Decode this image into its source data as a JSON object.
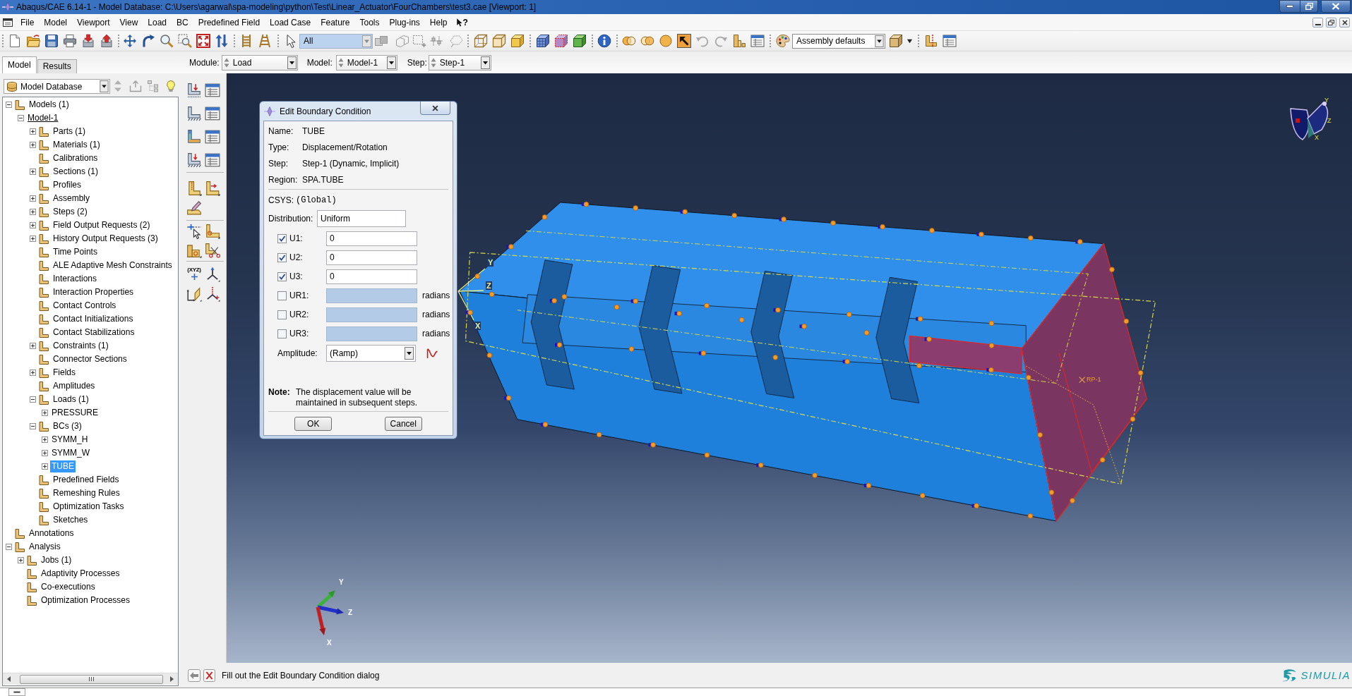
{
  "window": {
    "title": "Abaqus/CAE 6.14-1 - Model Database: C:\\Users\\agarwal\\spa-modeling\\python\\Test\\Linear_Actuator\\FourChambers\\test3.cae [Viewport: 1]"
  },
  "menu_bar": {
    "items": [
      "File",
      "Model",
      "Viewport",
      "View",
      "Load",
      "BC",
      "Predefined Field",
      "Load Case",
      "Feature",
      "Tools",
      "Plug-ins",
      "Help"
    ],
    "whats_this": "?"
  },
  "toolbar": {
    "selection_filter": "All",
    "render_style": "Assembly defaults"
  },
  "context_bar": {
    "fields": [
      {
        "label": "Module:",
        "value": "Load"
      },
      {
        "label": "Model:",
        "value": "Model-1"
      },
      {
        "label": "Step:",
        "value": "Step-1"
      }
    ]
  },
  "left_panel": {
    "tabs": [
      {
        "label": "Model",
        "selected": true
      },
      {
        "label": "Results",
        "selected": false
      }
    ],
    "database_selector": "Model Database",
    "tree": [
      {
        "label": "Models (1)",
        "kind": "container",
        "expanded": true,
        "selected": false,
        "current": false,
        "children": [
          {
            "label": "Model-1",
            "kind": "object",
            "expanded": true,
            "selected": false,
            "current": true,
            "children": [
              {
                "label": "Parts (1)",
                "kind": "container",
                "expanded": false,
                "selected": false,
                "current": false
              },
              {
                "label": "Materials (1)",
                "kind": "container",
                "expanded": false,
                "selected": false,
                "current": false
              },
              {
                "label": "Calibrations",
                "kind": "leaf",
                "selected": false,
                "current": false
              },
              {
                "label": "Sections (1)",
                "kind": "container",
                "expanded": false,
                "selected": false,
                "current": false
              },
              {
                "label": "Profiles",
                "kind": "leaf",
                "selected": false,
                "current": false
              },
              {
                "label": "Assembly",
                "kind": "container",
                "expanded": false,
                "selected": false,
                "current": false
              },
              {
                "label": "Steps (2)",
                "kind": "container",
                "expanded": false,
                "selected": false,
                "current": false
              },
              {
                "label": "Field Output Requests (2)",
                "kind": "container",
                "expanded": false,
                "selected": false,
                "current": false
              },
              {
                "label": "History Output Requests (3)",
                "kind": "container",
                "expanded": false,
                "selected": false,
                "current": false
              },
              {
                "label": "Time Points",
                "kind": "leaf",
                "selected": false,
                "current": false
              },
              {
                "label": "ALE Adaptive Mesh Constraints",
                "kind": "leaf",
                "selected": false,
                "current": false
              },
              {
                "label": "Interactions",
                "kind": "leaf",
                "selected": false,
                "current": false
              },
              {
                "label": "Interaction Properties",
                "kind": "leaf",
                "selected": false,
                "current": false
              },
              {
                "label": "Contact Controls",
                "kind": "leaf",
                "selected": false,
                "current": false
              },
              {
                "label": "Contact Initializations",
                "kind": "leaf",
                "selected": false,
                "current": false
              },
              {
                "label": "Contact Stabilizations",
                "kind": "leaf",
                "selected": false,
                "current": false
              },
              {
                "label": "Constraints (1)",
                "kind": "container",
                "expanded": false,
                "selected": false,
                "current": false
              },
              {
                "label": "Connector Sections",
                "kind": "leaf",
                "selected": false,
                "current": false
              },
              {
                "label": "Fields",
                "kind": "container",
                "expanded": false,
                "selected": false,
                "current": false
              },
              {
                "label": "Amplitudes",
                "kind": "leaf",
                "selected": false,
                "current": false
              },
              {
                "label": "Loads (1)",
                "kind": "container",
                "expanded": true,
                "selected": false,
                "current": false,
                "children": [
                  {
                    "label": "PRESSURE",
                    "kind": "object",
                    "expanded": false,
                    "selected": false,
                    "current": false
                  }
                ]
              },
              {
                "label": "BCs (3)",
                "kind": "container",
                "expanded": true,
                "selected": false,
                "current": false,
                "children": [
                  {
                    "label": "SYMM_H",
                    "kind": "object",
                    "expanded": false,
                    "selected": false,
                    "current": false
                  },
                  {
                    "label": "SYMM_W",
                    "kind": "object",
                    "expanded": false,
                    "selected": false,
                    "current": false
                  },
                  {
                    "label": "TUBE",
                    "kind": "object",
                    "expanded": false,
                    "selected": true,
                    "current": false
                  }
                ]
              },
              {
                "label": "Predefined Fields",
                "kind": "leaf",
                "selected": false,
                "current": false
              },
              {
                "label": "Remeshing Rules",
                "kind": "leaf",
                "selected": false,
                "current": false
              },
              {
                "label": "Optimization Tasks",
                "kind": "leaf",
                "selected": false,
                "current": false
              },
              {
                "label": "Sketches",
                "kind": "leaf",
                "selected": false,
                "current": false
              }
            ]
          }
        ]
      },
      {
        "label": "Annotations",
        "kind": "leaf",
        "selected": false,
        "current": false
      },
      {
        "label": "Analysis",
        "kind": "container",
        "expanded": true,
        "selected": false,
        "current": false,
        "children": [
          {
            "label": "Jobs (1)",
            "kind": "container",
            "expanded": false,
            "selected": false,
            "current": false
          },
          {
            "label": "Adaptivity Processes",
            "kind": "leaf",
            "selected": false,
            "current": false
          },
          {
            "label": "Co-executions",
            "kind": "leaf",
            "selected": false,
            "current": false
          },
          {
            "label": "Optimization Processes",
            "kind": "leaf",
            "selected": false,
            "current": false
          }
        ]
      }
    ]
  },
  "toolbox": {
    "point_tool_label": "(XYZ)"
  },
  "dialog": {
    "title": "Edit Boundary Condition",
    "info": [
      {
        "label": "Name:",
        "value": "TUBE"
      },
      {
        "label": "Type:",
        "value": "Displacement/Rotation"
      },
      {
        "label": "Step:",
        "value": "Step-1 (Dynamic, Implicit)"
      },
      {
        "label": "Region:",
        "value": "SPA.TUBE"
      }
    ],
    "csys": {
      "label": "CSYS:",
      "value": "(Global)"
    },
    "distribution": {
      "label": "Distribution:",
      "value": "Uniform"
    },
    "components": [
      {
        "label": "U1:",
        "checked": true,
        "value": "0"
      },
      {
        "label": "U2:",
        "checked": true,
        "value": "0"
      },
      {
        "label": "U3:",
        "checked": true,
        "value": "0"
      },
      {
        "label": "UR1:",
        "checked": false,
        "unit": "radians"
      },
      {
        "label": "UR2:",
        "checked": false,
        "unit": "radians"
      },
      {
        "label": "UR3:",
        "checked": false,
        "unit": "radians"
      }
    ],
    "amplitude": {
      "label": "Amplitude:",
      "value": "(Ramp)"
    },
    "note": {
      "label": "Note:",
      "text": "The displacement value will be maintained in subsequent steps."
    },
    "buttons": [
      "OK",
      "Cancel"
    ]
  },
  "viewport": {
    "datum_csys_labels": {
      "x": "X",
      "y": "Y",
      "z": "Z"
    },
    "reference_point_label": "RP-1",
    "triad_labels": {
      "x": "X",
      "y": "Y",
      "z": "Z"
    },
    "view_cube_labels": {
      "x": "X",
      "y": "Y",
      "z": "Z"
    }
  },
  "prompt": {
    "text": "Fill out the Edit Boundary Condition dialog"
  },
  "logo": {
    "text": "SIMULIA"
  }
}
